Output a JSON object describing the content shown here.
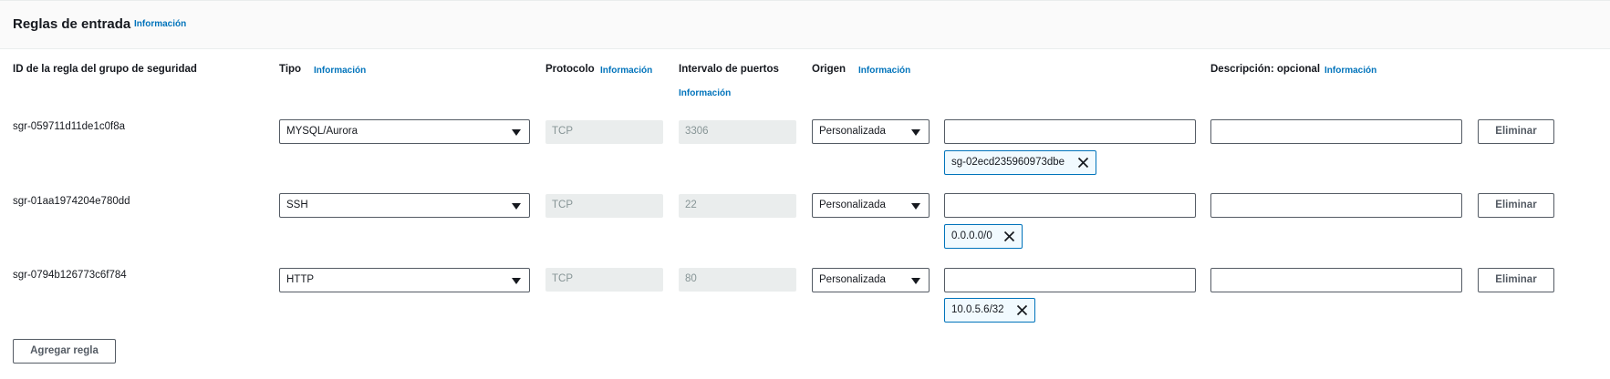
{
  "section": {
    "title": "Reglas de entrada",
    "info": "Información"
  },
  "columns": {
    "id": "ID de la regla del grupo de seguridad",
    "type": "Tipo",
    "type_info": "Información",
    "protocol": "Protocolo",
    "protocol_info": "Información",
    "ports": "Intervalo de puertos",
    "ports_info": "Información",
    "source": "Origen",
    "source_info": "Información",
    "description": "Descripción: opcional",
    "description_info": "Información"
  },
  "rules": [
    {
      "id": "sgr-059711d11de1c0f8a",
      "type": "MYSQL/Aurora",
      "protocol": "TCP",
      "port": "3306",
      "source_type": "Personalizada",
      "source_search": "",
      "source_token": "sg-02ecd235960973dbe",
      "description": "",
      "delete_label": "Eliminar"
    },
    {
      "id": "sgr-01aa1974204e780dd",
      "type": "SSH",
      "protocol": "TCP",
      "port": "22",
      "source_type": "Personalizada",
      "source_search": "",
      "source_token": "0.0.0.0/0",
      "description": "",
      "delete_label": "Eliminar"
    },
    {
      "id": "sgr-0794b126773c6f784",
      "type": "HTTP",
      "protocol": "TCP",
      "port": "80",
      "source_type": "Personalizada",
      "source_search": "",
      "source_token": "10.0.5.6/32",
      "description": "",
      "delete_label": "Eliminar"
    }
  ],
  "add_rule_label": "Agregar regla",
  "icons": {
    "search": "search-icon",
    "remove": "close-icon",
    "dropdown": "caret-down-icon"
  },
  "colors": {
    "link": "#0073bb",
    "token_border": "#0073bb",
    "input_border": "#545b64",
    "disabled_bg": "#eaeded"
  }
}
